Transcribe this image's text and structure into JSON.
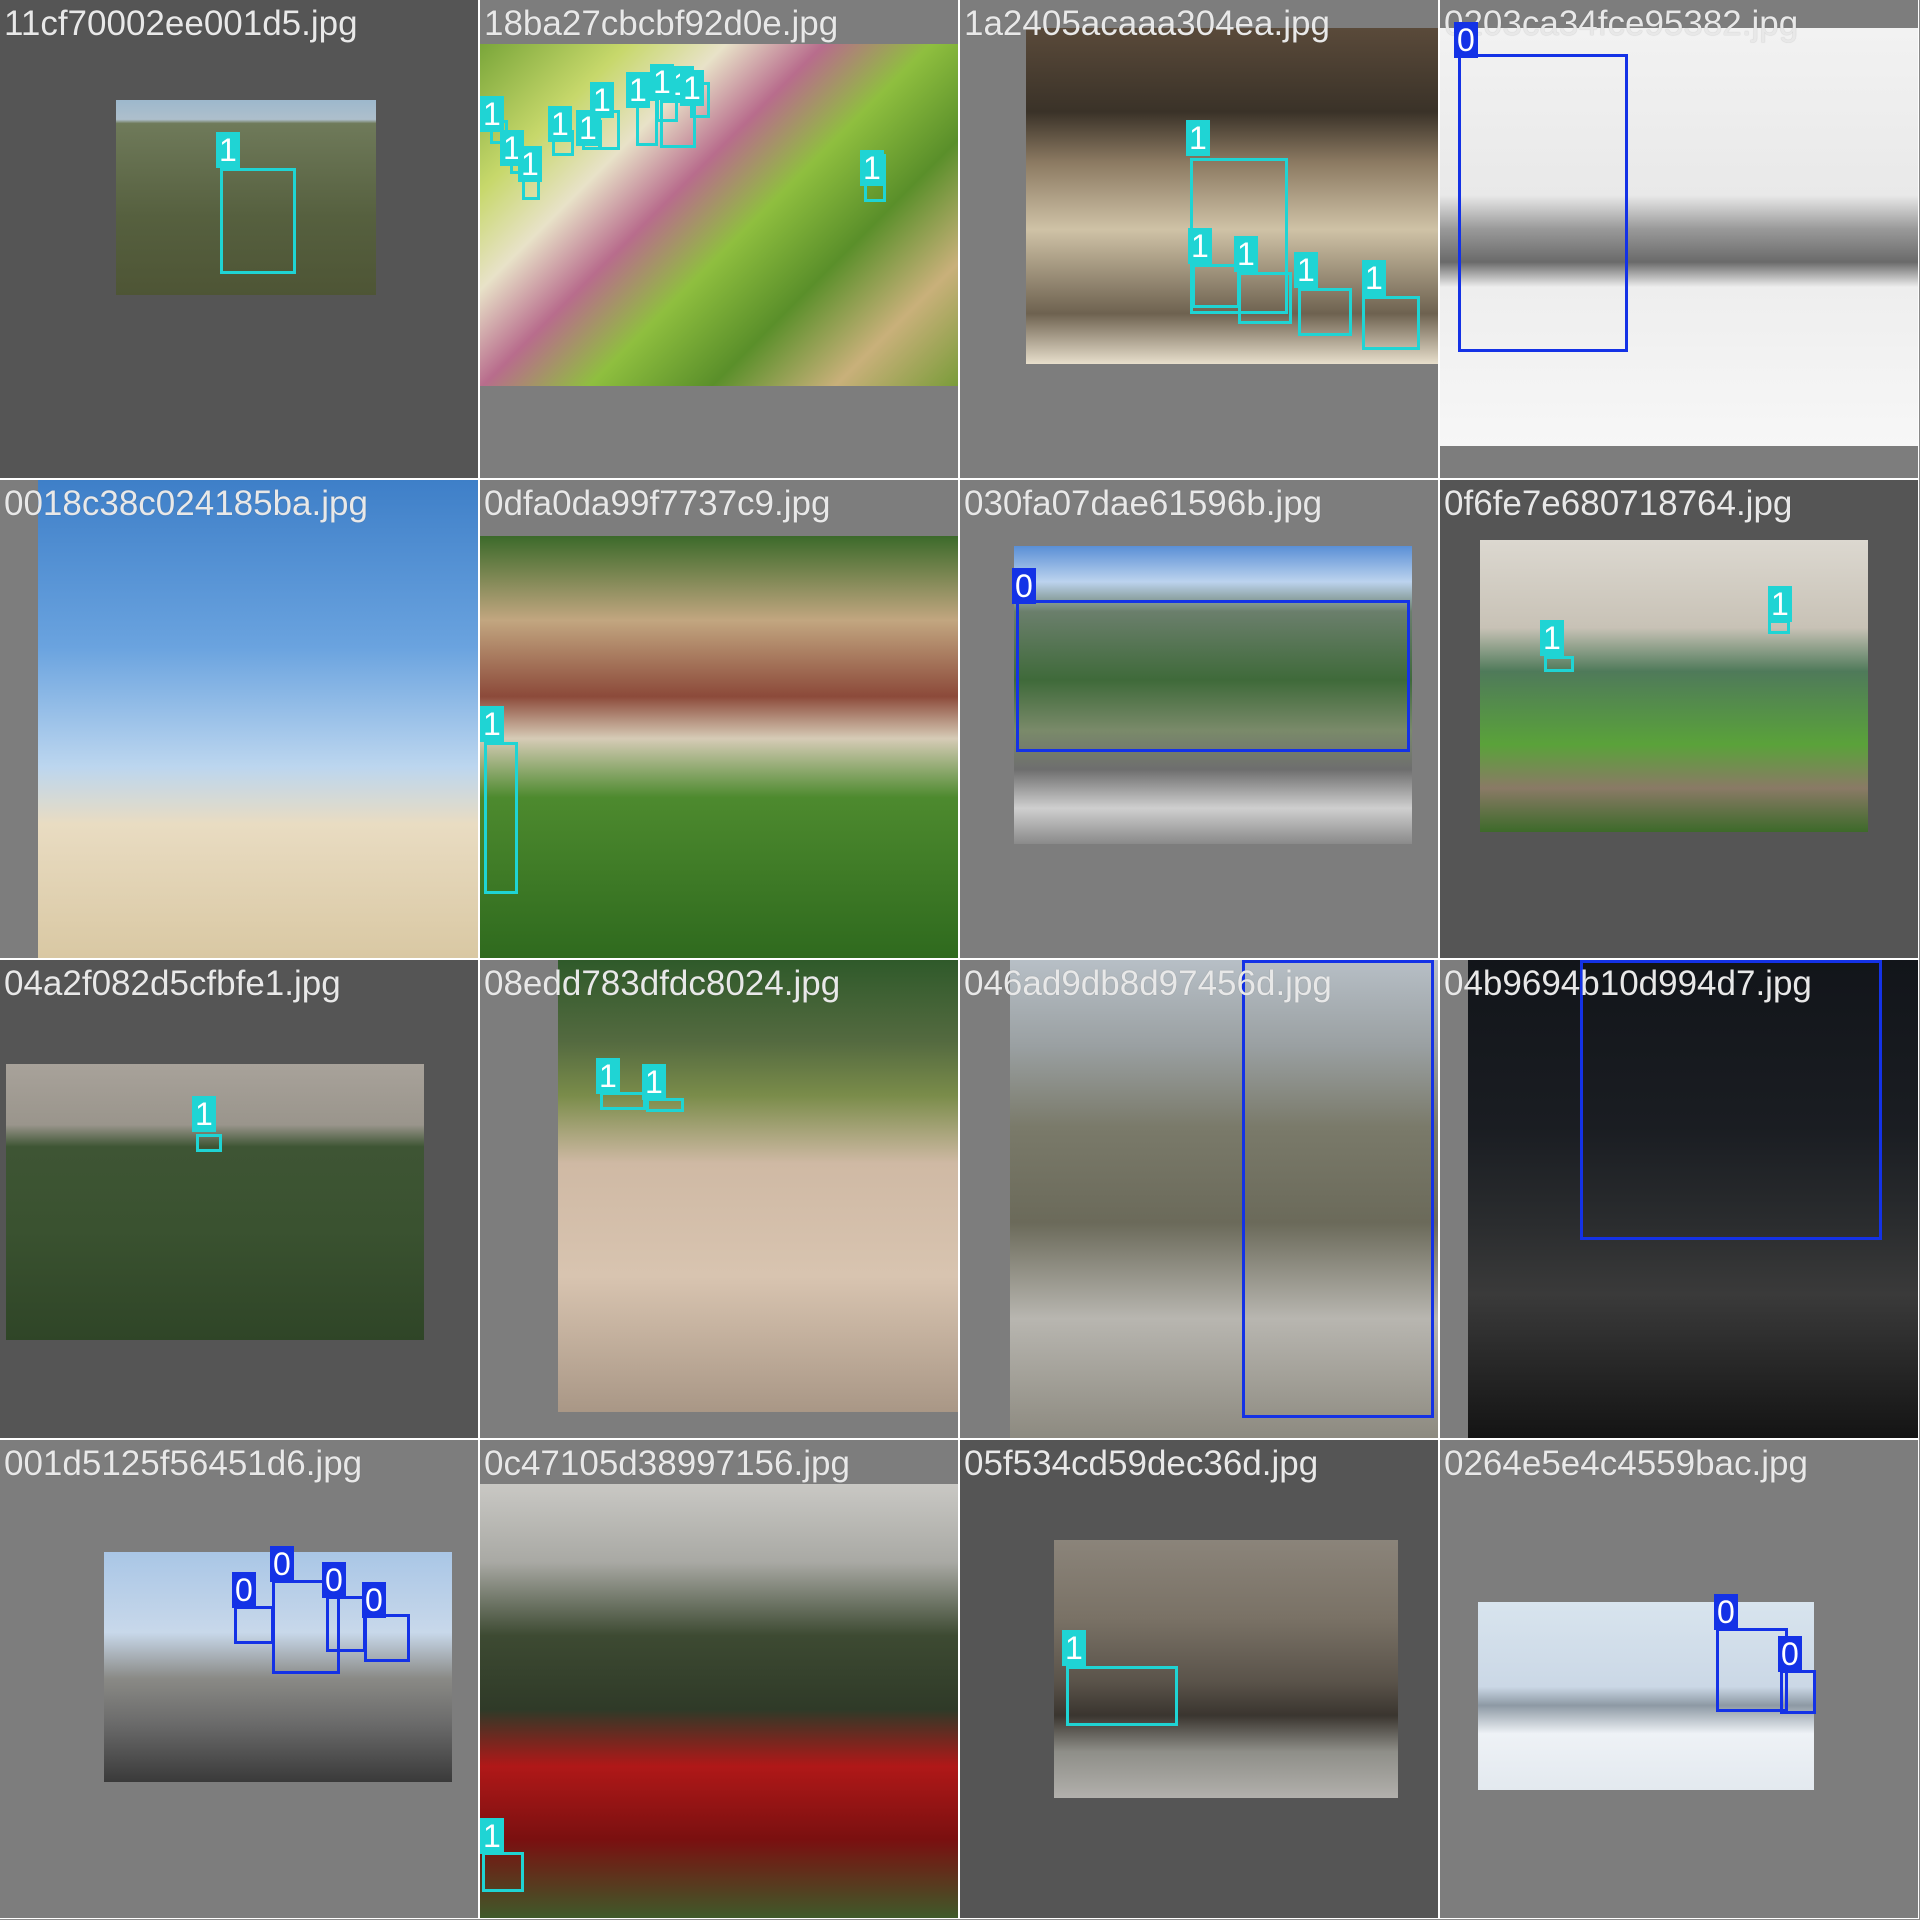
{
  "colors": {
    "class_0": "#1432e6",
    "class_1": "#1fd4d4",
    "tile_border": "#ffffff"
  },
  "tiles": [
    {
      "filename": "11cf70002ee001d5.jpg",
      "labels": [
        "1"
      ]
    },
    {
      "filename": "18ba27cbcbf92d0e.jpg",
      "labels": [
        "1",
        "1",
        "1",
        "1",
        "1",
        "1",
        "1",
        "1",
        "1",
        "1",
        "1"
      ]
    },
    {
      "filename": "1a2405acaaa304ea.jpg",
      "labels": [
        "1",
        "1",
        "1",
        "1",
        "1"
      ]
    },
    {
      "filename": "0203ca34fce95382.jpg",
      "labels": [
        "0"
      ]
    },
    {
      "filename": "0018c38c024185ba.jpg",
      "labels": []
    },
    {
      "filename": "0dfa0da99f7737c9.jpg",
      "labels": [
        "1"
      ]
    },
    {
      "filename": "030fa07dae61596b.jpg",
      "labels": [
        "0"
      ]
    },
    {
      "filename": "0f6fe7e680718764.jpg",
      "labels": [
        "1",
        "1"
      ]
    },
    {
      "filename": "04a2f082d5cfbfe1.jpg",
      "labels": [
        "1"
      ]
    },
    {
      "filename": "08edd783dfdc8024.jpg",
      "labels": [
        "1",
        "1"
      ]
    },
    {
      "filename": "046ad9db8d97456d.jpg",
      "labels": [
        "0"
      ]
    },
    {
      "filename": "04b9694b10d994d7.jpg",
      "labels": [
        "0"
      ]
    },
    {
      "filename": "001d5125f56451d6.jpg",
      "labels": [
        "0",
        "0",
        "0",
        "0"
      ]
    },
    {
      "filename": "0c47105d38997156.jpg",
      "labels": [
        "1"
      ]
    },
    {
      "filename": "05f534cd59dec36d.jpg",
      "labels": [
        "1"
      ]
    },
    {
      "filename": "0264e5e4c4559bac.jpg",
      "labels": [
        "0",
        "0"
      ]
    }
  ]
}
